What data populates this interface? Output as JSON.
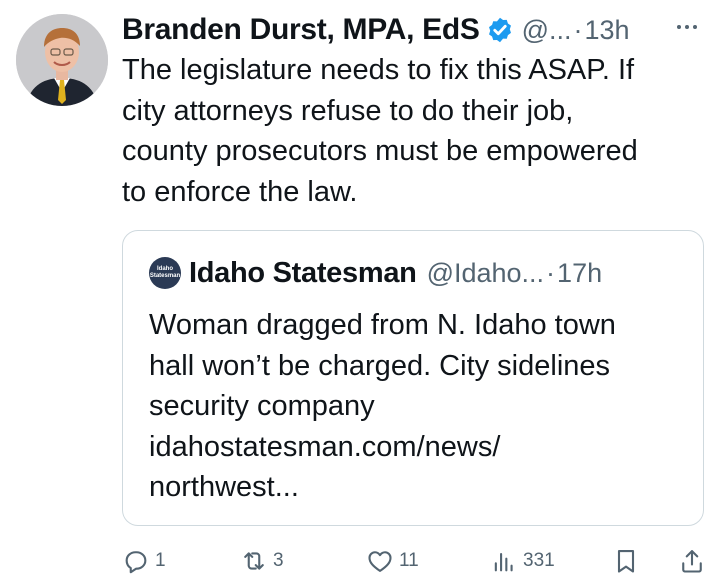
{
  "tweet": {
    "author_name": "Branden Durst, MPA, EdS",
    "handle": "@...",
    "separator": "·",
    "time": "13h",
    "text": "The legislature needs to fix this ASAP. If\ncity attorneys refuse to do their job,\ncounty prosecutors must be empowered\nto enforce the law."
  },
  "quote": {
    "logo_text": [
      "Idaho",
      "Statesman"
    ],
    "name": "Idaho Statesman",
    "handle": "@Idaho...",
    "separator": "·",
    "time": "17h",
    "text": "Woman dragged from N. Idaho town\nhall won’t be charged. City sidelines\nsecurity company\nidahostatesman.com/news/\nnorthwest..."
  },
  "actions": {
    "replies": "1",
    "reposts": "3",
    "likes": "11",
    "views": "331"
  },
  "icons": {
    "verified": "verified-badge-icon",
    "more": "more-icon",
    "reply": "reply-icon",
    "repost": "repost-icon",
    "like": "like-icon",
    "views": "views-icon",
    "bookmark": "bookmark-icon",
    "share": "share-icon"
  },
  "colors": {
    "verified": "#1d9bf0",
    "secondary_text": "#536471",
    "border": "#cfd9de",
    "logo_bg": "#2b3a55"
  }
}
